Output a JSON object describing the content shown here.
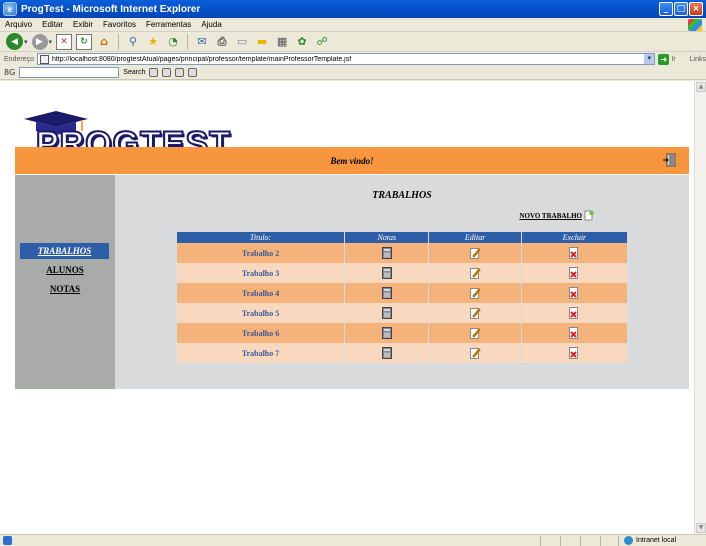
{
  "window": {
    "title": "ProgTest - Microsoft Internet Explorer"
  },
  "menu": [
    "Arquivo",
    "Editar",
    "Exibir",
    "Favoritos",
    "Ferramentas",
    "Ajuda"
  ],
  "address": {
    "label": "Endereço",
    "url": "http://localhost:8080/progtestAtual/pages/principal/professor/template/mainProfessorTemplate.jsf",
    "go_label": "Ir",
    "links_label": "Links"
  },
  "search_toolbar": {
    "brand": "8G",
    "search_label": "Search"
  },
  "page": {
    "logo_text": "PROGTEST",
    "welcome": "Bem vindo!",
    "nav": [
      {
        "label": "TRABALHOS",
        "active": true
      },
      {
        "label": "ALUNOS",
        "active": false
      },
      {
        "label": "NOTAS",
        "active": false
      }
    ],
    "heading": "TRABALHOS",
    "new_link": "NOVO TRABALHO",
    "table": {
      "headers": [
        "Titulo:",
        "Notas",
        "Editar",
        "Excluir"
      ],
      "rows": [
        "Trabalho 2",
        "Trabalho 3",
        "Trabalho 4",
        "Trabalho 5",
        "Trabalho 6",
        "Trabalho 7"
      ]
    }
  },
  "status": {
    "zone": "Intranet local"
  },
  "colors": {
    "banner": "#f8963f",
    "header_blue": "#2f5ea8",
    "row_dark": "#f5b37c",
    "row_light": "#f8d9c0",
    "sidebar": "#a8aba8",
    "content_bg": "#d8dadb"
  },
  "icons": {
    "notas": "calculator-icon",
    "editar": "edit-icon",
    "excluir": "delete-icon",
    "exit": "exit-door-icon",
    "new": "new-page-icon"
  }
}
